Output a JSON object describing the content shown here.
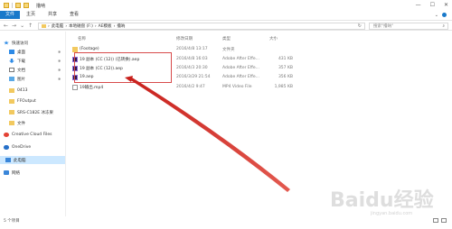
{
  "window": {
    "title": "撸呐",
    "controls": [
      "—",
      "☐",
      "✕"
    ]
  },
  "ribbon": {
    "file_tab": "文件",
    "tabs": [
      "主页",
      "共享",
      "查看"
    ]
  },
  "address": {
    "crumbs": [
      "此电脑",
      "本地磁盘 (F:)",
      "AE模板",
      "撸呐"
    ],
    "search_placeholder": "搜索\"撸呐\""
  },
  "sidebar": {
    "items": [
      {
        "label": "快速访问",
        "icon": "star-icon"
      },
      {
        "label": "桌面",
        "icon": "desktop-icon"
      },
      {
        "label": "下载",
        "icon": "download-icon"
      },
      {
        "label": "文档",
        "icon": "document-icon"
      },
      {
        "label": "图片",
        "icon": "picture-icon"
      },
      {
        "label": "0413",
        "icon": "folder-icon"
      },
      {
        "label": "FFOutput",
        "icon": "folder-icon"
      },
      {
        "label": "SRS-C182E 冰冻果",
        "icon": "folder-icon"
      },
      {
        "label": "文件",
        "icon": "folder-icon"
      },
      {
        "label": "Creative Cloud Files",
        "icon": "creative-cloud-icon"
      },
      {
        "label": "OneDrive",
        "icon": "onedrive-icon"
      },
      {
        "label": "此电脑",
        "icon": "computer-icon"
      },
      {
        "label": "网络",
        "icon": "network-icon"
      }
    ]
  },
  "columns": {
    "name": "名称",
    "date": "修改日期",
    "type": "类型",
    "size": "大小"
  },
  "files": [
    {
      "name": "(Footage)",
      "date": "2016/4/8 13:17",
      "type": "文件夹",
      "size": "",
      "icon": "folder-icon"
    },
    {
      "name": "19 副本 (CC (12)) (已转换).aep",
      "date": "2016/4/8 16:03",
      "type": "Adobe After Effe...",
      "size": "431 KB",
      "icon": "ae-file-icon"
    },
    {
      "name": "19 副本 (CC (12)).aep",
      "date": "2016/4/3 20:30",
      "type": "Adobe After Effe...",
      "size": "357 KB",
      "icon": "ae-file-icon"
    },
    {
      "name": "19.aep",
      "date": "2016/3/29 21:54",
      "type": "Adobe After Effe...",
      "size": "356 KB",
      "icon": "ae-file-icon"
    },
    {
      "name": "19输出.mp4",
      "date": "2016/4/2 9:47",
      "type": "MP4 Video File",
      "size": "1,985 KB",
      "icon": "video-file-icon"
    }
  ],
  "status": {
    "count": "5 个项目"
  },
  "watermark": {
    "text": "Baidu经验",
    "sub": "jingyan.baidu.com"
  },
  "colors": {
    "accent": "#1979ca",
    "highlight": "#d84b4b",
    "arrow": "#d9302c"
  }
}
